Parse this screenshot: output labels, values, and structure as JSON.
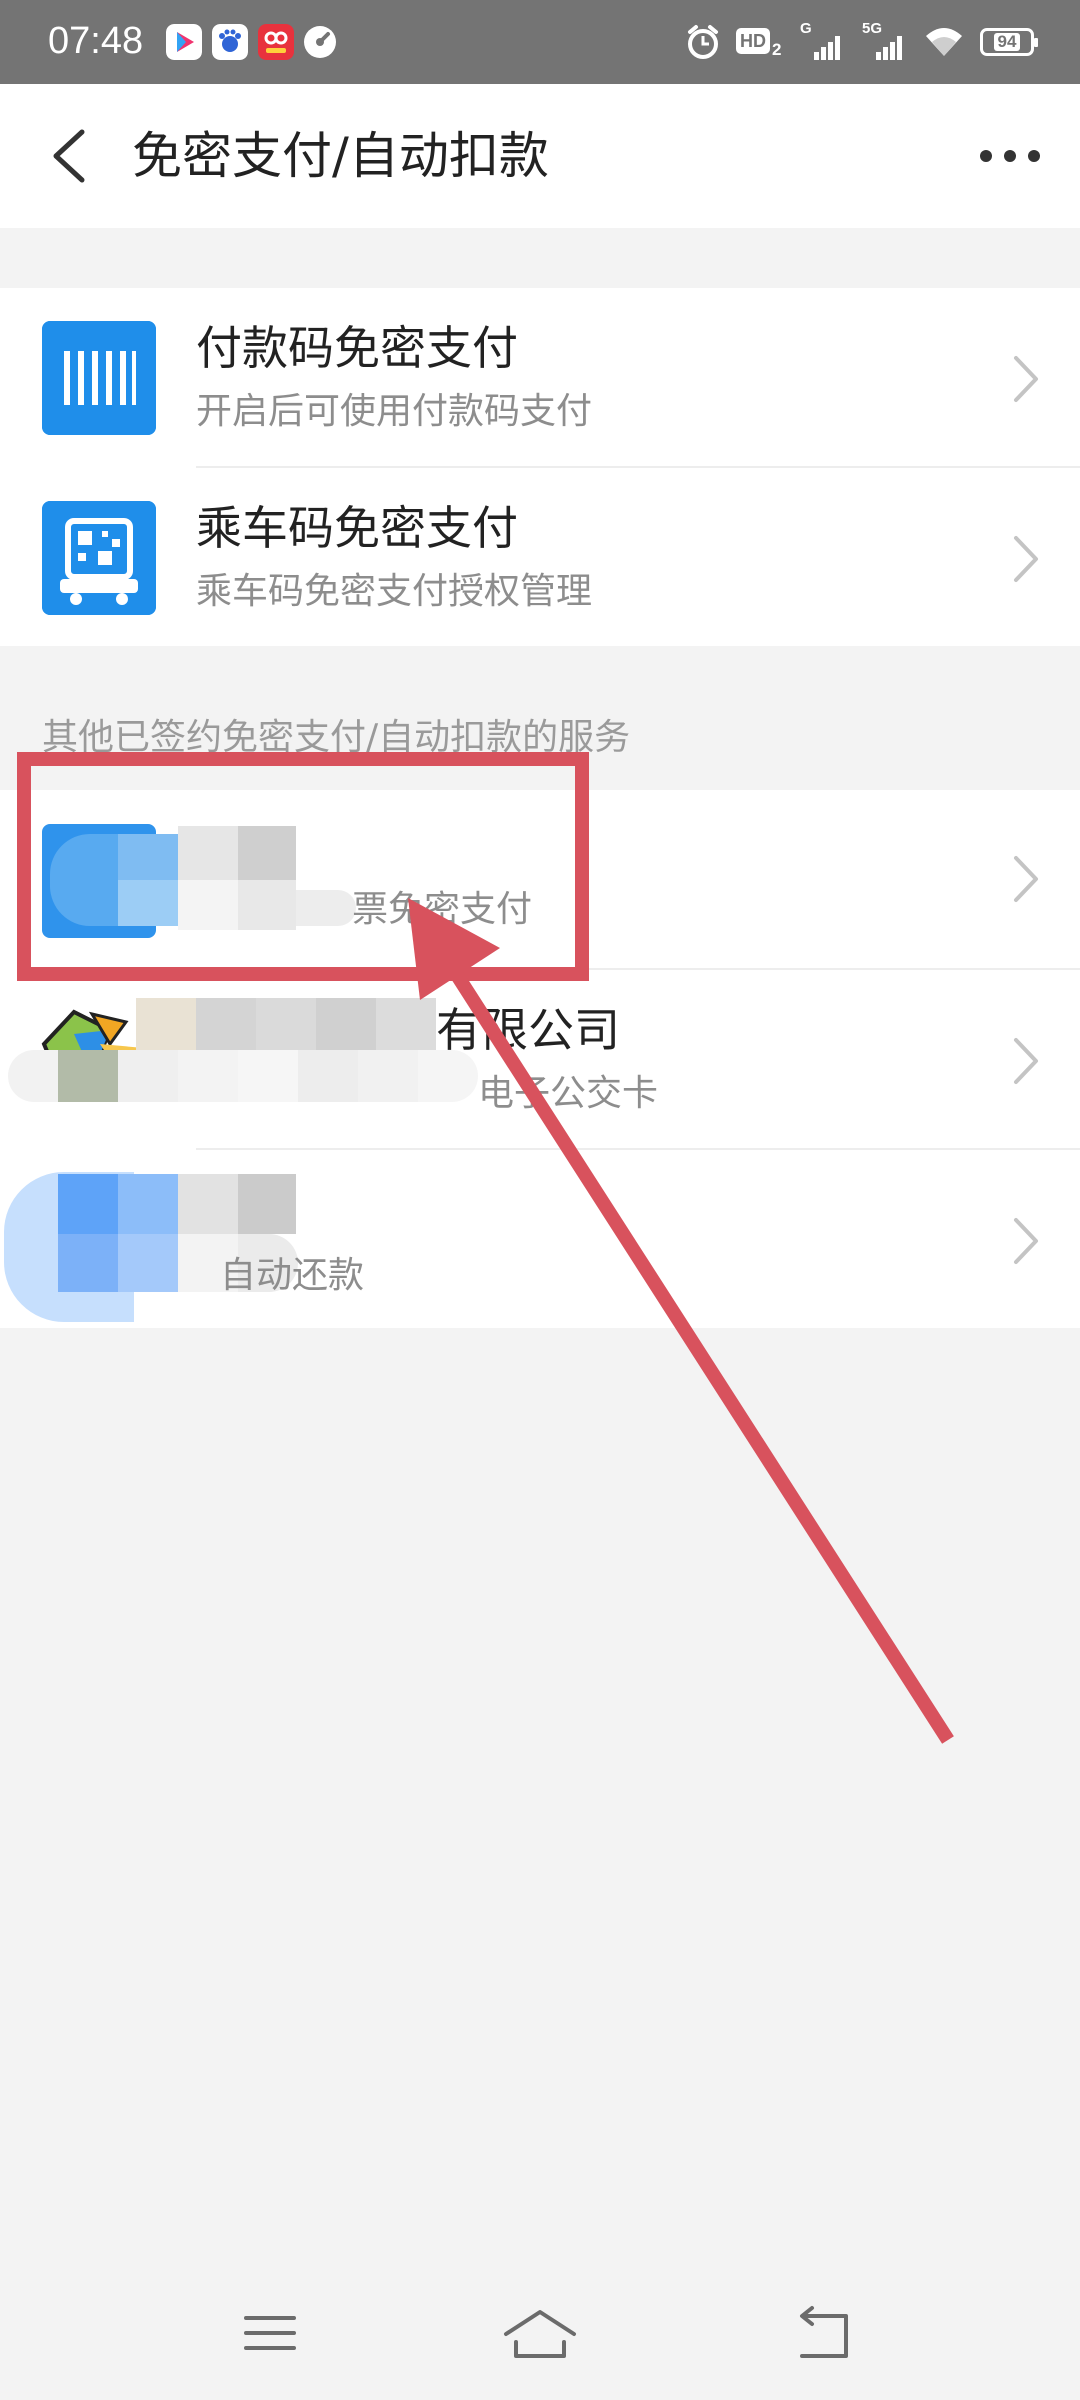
{
  "status_bar": {
    "time": "07:48",
    "app_icons": [
      "video-app-icon",
      "baidu-icon",
      "shopping-app-icon",
      "speed-app-icon"
    ],
    "right_icons": [
      "alarm-icon",
      "hd-icon",
      "signal-g-icon",
      "signal-5g-icon",
      "wifi-icon"
    ],
    "signal_g": "G",
    "signal_5g": "5G",
    "hd": "HD",
    "battery": "94"
  },
  "header": {
    "title": "免密支付/自动扣款",
    "back_icon": "back-arrow-icon",
    "more_icon": "more-icon"
  },
  "main_items": [
    {
      "title": "付款码免密支付",
      "subtitle": "开启后可使用付款码支付",
      "icon": "barcode-icon"
    },
    {
      "title": "乘车码免密支付",
      "subtitle": "乘车码免密支付授权管理",
      "icon": "transit-code-icon"
    }
  ],
  "section_header": "其他已签约免密支付/自动扣款的服务",
  "services": [
    {
      "title": "",
      "subtitle": "票免密支付"
    },
    {
      "title": "有限公司",
      "subtitle": "电子公交卡"
    },
    {
      "title": "",
      "subtitle": "自动还款"
    }
  ],
  "colors": {
    "accent_blue": "#1f8eea",
    "annotation_red": "#d8525d",
    "status_bar_gray": "#747474"
  },
  "nav": {
    "menu_icon": "menu-icon",
    "home_icon": "home-icon",
    "back_icon": "back-icon"
  }
}
